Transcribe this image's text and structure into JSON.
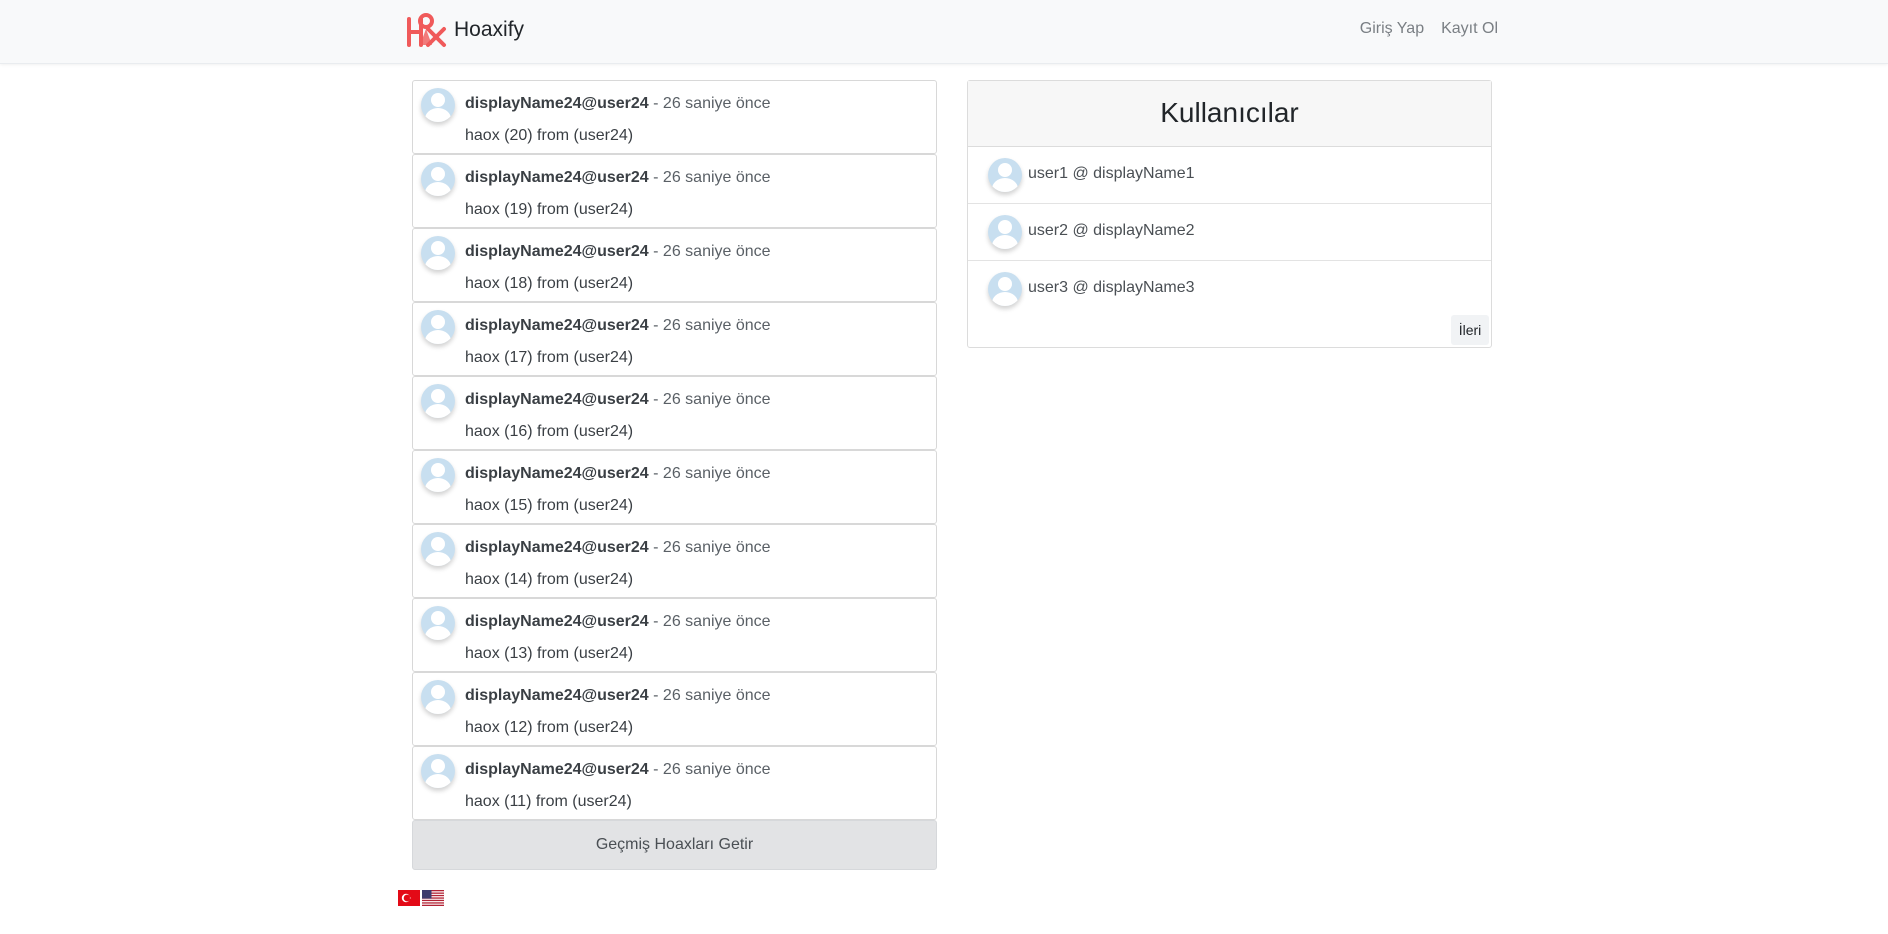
{
  "navbar": {
    "brand": "Hoaxify",
    "login": "Giriş Yap",
    "signup": "Kayıt Ol"
  },
  "hoaxes": [
    {
      "user": "displayName24@user24",
      "separator": " - ",
      "time": "26 saniye önce",
      "content": "haox (20) from (user24)"
    },
    {
      "user": "displayName24@user24",
      "separator": " - ",
      "time": "26 saniye önce",
      "content": "haox (19) from (user24)"
    },
    {
      "user": "displayName24@user24",
      "separator": " - ",
      "time": "26 saniye önce",
      "content": "haox (18) from (user24)"
    },
    {
      "user": "displayName24@user24",
      "separator": " - ",
      "time": "26 saniye önce",
      "content": "haox (17) from (user24)"
    },
    {
      "user": "displayName24@user24",
      "separator": " - ",
      "time": "26 saniye önce",
      "content": "haox (16) from (user24)"
    },
    {
      "user": "displayName24@user24",
      "separator": " - ",
      "time": "26 saniye önce",
      "content": "haox (15) from (user24)"
    },
    {
      "user": "displayName24@user24",
      "separator": " - ",
      "time": "26 saniye önce",
      "content": "haox (14) from (user24)"
    },
    {
      "user": "displayName24@user24",
      "separator": " - ",
      "time": "26 saniye önce",
      "content": "haox (13) from (user24)"
    },
    {
      "user": "displayName24@user24",
      "separator": " - ",
      "time": "26 saniye önce",
      "content": "haox (12) from (user24)"
    },
    {
      "user": "displayName24@user24",
      "separator": " - ",
      "time": "26 saniye önce",
      "content": "haox (11) from (user24)"
    }
  ],
  "load_more_label": "Geçmiş Hoaxları Getir",
  "users": {
    "title": "Kullanıcılar",
    "items": [
      {
        "label": "user1 @ displayName1"
      },
      {
        "label": "user2 @ displayName2"
      },
      {
        "label": "user3 @ displayName3"
      }
    ],
    "next_label": "İleri"
  },
  "languages": {
    "tr_icon": "turkey-flag-icon",
    "en_icon": "us-flag-icon"
  },
  "colors": {
    "logo": "#f05a5a",
    "avatar": "#c8dff0",
    "navbar_bg": "#f8f9fa",
    "load_more_bg": "#e2e3e5"
  }
}
